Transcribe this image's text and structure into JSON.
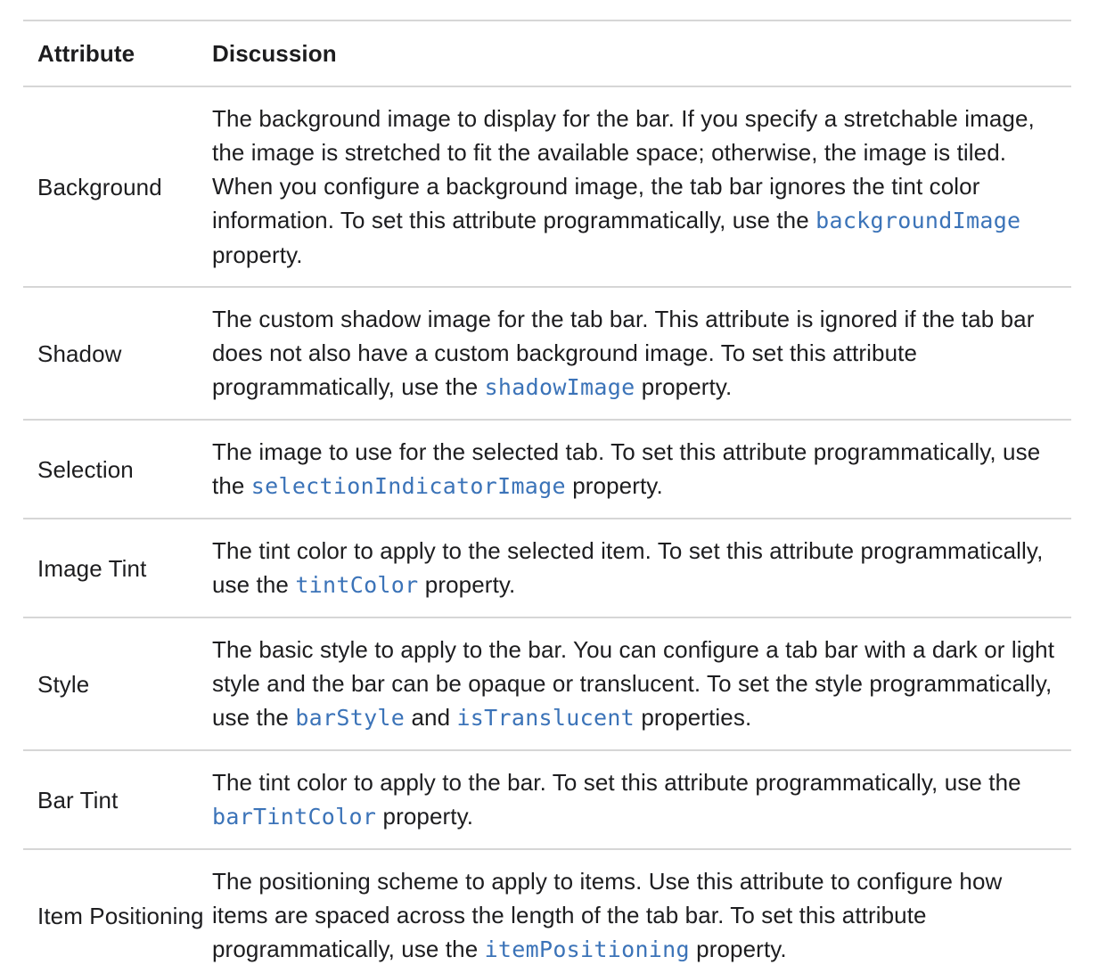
{
  "colors": {
    "text": "#1d1d1f",
    "link": "#3b73b8",
    "divider": "#d6d6d6",
    "background": "#ffffff"
  },
  "table": {
    "headers": {
      "attribute": "Attribute",
      "discussion": "Discussion"
    },
    "rows": [
      {
        "attribute": "Background",
        "text_before": "The background image to display for the bar. If you specify a stretchable image, the image is stretched to fit the available space; otherwise, the image is tiled. When you configure a background image, the tab bar ignores the tint color information. To set this attribute programmatically, use the ",
        "link1": "backgroundImage",
        "text_after": " property."
      },
      {
        "attribute": "Shadow",
        "text_before": "The custom shadow image for the tab bar. This attribute is ignored if the tab bar does not also have a custom background image. To set this attribute programmatically, use the ",
        "link1": "shadowImage",
        "text_after": " property."
      },
      {
        "attribute": "Selection",
        "text_before": "The image to use for the selected tab. To set this attribute programmatically, use the ",
        "link1": "selectionIndicatorImage",
        "text_after": " property."
      },
      {
        "attribute": "Image Tint",
        "text_before": "The tint color to apply to the selected item. To set this attribute programmatically, use the ",
        "link1": "tintColor",
        "text_after": " property."
      },
      {
        "attribute": "Style",
        "text_before": "The basic style to apply to the bar. You can configure a tab bar with a dark or light style and the bar can be opaque or translucent. To set the style programmatically, use the ",
        "link1": "barStyle",
        "text_middle": " and ",
        "link2": "isTranslucent",
        "text_after": " properties."
      },
      {
        "attribute": "Bar Tint",
        "text_before": "The tint color to apply to the bar. To set this attribute programmatically, use the ",
        "link1": "barTintColor",
        "text_after": " property."
      },
      {
        "attribute": "Item Positioning",
        "text_before": "The positioning scheme to apply to items. Use this attribute to configure how items are spaced across the length of the tab bar. To set this attribute programmatically, use the ",
        "link1": "itemPositioning",
        "text_after": " property."
      }
    ]
  }
}
